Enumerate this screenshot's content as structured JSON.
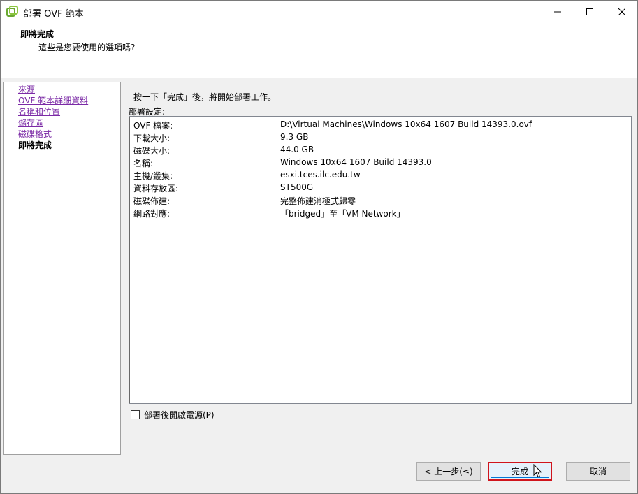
{
  "window": {
    "title": "部署 OVF 範本",
    "controls": {
      "minimize": "minimize-icon",
      "maximize": "maximize-icon",
      "close": "close-icon"
    }
  },
  "header": {
    "title": "即將完成",
    "subtitle": "這些是您要使用的選項嗎?"
  },
  "nav": {
    "items": [
      {
        "label": "來源",
        "state": "visited"
      },
      {
        "label": "OVF 範本詳細資料",
        "state": "visited"
      },
      {
        "label": "名稱和位置",
        "state": "visited"
      },
      {
        "label": "儲存區",
        "state": "visited"
      },
      {
        "label": "磁碟格式",
        "state": "visited"
      },
      {
        "label": "即將完成",
        "state": "current"
      }
    ]
  },
  "main": {
    "instruction": "按一下「完成」後，將開始部署工作。",
    "settings_label": "部署設定:",
    "settings": [
      {
        "key": "OVF 檔案:",
        "value": "D:\\Virtual Machines\\Windows 10x64 1607 Build 14393.0.ovf"
      },
      {
        "key": "下載大小:",
        "value": "9.3 GB"
      },
      {
        "key": "磁碟大小:",
        "value": "44.0 GB"
      },
      {
        "key": "名稱:",
        "value": "Windows 10x64 1607 Build 14393.0"
      },
      {
        "key": "主機/叢集:",
        "value": "esxi.tces.ilc.edu.tw"
      },
      {
        "key": "資料存放區:",
        "value": "ST500G"
      },
      {
        "key": "磁碟佈建:",
        "value": "完整佈建消極式歸零"
      },
      {
        "key": "網路對應:",
        "value": "「bridged」至「VM Network」"
      }
    ],
    "power_on_checkbox": {
      "label": "部署後開啟電源(P)",
      "checked": false
    }
  },
  "footer": {
    "back_label": "< 上一步(≤)",
    "finish_label": "完成",
    "cancel_label": "取消"
  },
  "colors": {
    "visited_link": "#7b2aa6",
    "highlight_border": "#d0141c",
    "vmware_icon": "#6aa832"
  }
}
